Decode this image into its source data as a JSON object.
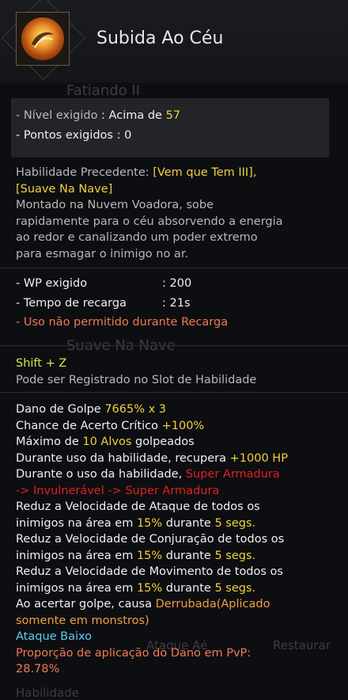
{
  "skill": {
    "title": "Subida Ao Céu",
    "icon": "skill-icon-fire-swirl"
  },
  "ghost_texts": {
    "top": "Fatiando II",
    "middle": "Suave Na Nave",
    "bottom_left": "Habilidade",
    "bottom_mid": "Ataque Aé",
    "bottom_right": "Restaurar"
  },
  "requirements": {
    "level_label": "- Nível exigido",
    "level_sep": " : Acima de ",
    "level_value": "57",
    "points_label": "- Pontos exigidos : 0"
  },
  "description": {
    "prereq_label": "Habilidade Precedente: ",
    "prereq_1": "[Vem que Tem III],",
    "prereq_2": "[Suave Na Nave]",
    "text_1": "Montado na Nuvem Voadora, sobe",
    "text_2": "rapidamente para o céu absorvendo a energia",
    "text_3": "ao redor e canalizando um poder extremo",
    "text_4": "para esmagar o inimigo no ar."
  },
  "costs": {
    "wp_label": "- WP exigido",
    "wp_value": ": 200",
    "cd_label": "- Tempo de recarga",
    "cd_value": ": 21s",
    "cd_note": "- Uso não permitido durante Recarga"
  },
  "command": {
    "keys": "Shift + Z",
    "slot_note": "Pode ser Registrado no Slot de Habilidade"
  },
  "effects": {
    "dmg_label": "Dano de Golpe ",
    "dmg_value": "7665% x 3",
    "crit_label": "Chance de Acerto Crítico ",
    "crit_value": "+100%",
    "max_label": "Máximo de ",
    "max_value": "10 Alvos",
    "max_suffix": " golpeados",
    "hp_label": "Durante uso da habilidade, recupera ",
    "hp_value": "+1000 HP",
    "armor_label": "Durante o uso da habilidade, ",
    "armor_value_1": "Super Armadura",
    "armor_value_2": "-> Invulnerável -> Super Armadura",
    "atk_1": "Reduz a Velocidade de Ataque de todos os",
    "atk_2a": "inimigos na área em ",
    "atk_pct": "15%",
    "atk_2b": " durante ",
    "atk_time": "5 segs.",
    "cast_1": "Reduz a Velocidade de Conjuração de todos os",
    "cast_2a": "inimigos na área em ",
    "cast_pct": "15%",
    "cast_2b": " durante ",
    "cast_time": "5 segs.",
    "move_1": "Reduz a Velocidade de Movimento de todos os",
    "move_2a": "inimigos na área em ",
    "move_pct": "15%",
    "move_2b": " durante ",
    "move_time": "5 segs.",
    "kd_label": "Ao acertar golpe, causa ",
    "kd_value_1": "Derrubada(Aplicado",
    "kd_value_2": "somente em monstros)",
    "low_attack": "Ataque Baixo",
    "pvp_label": "Proporção de aplicação do Dano em PvP:",
    "pvp_value": "28.78%"
  },
  "colors": {
    "highlight_yellow": "#f0d040",
    "highlight_orange": "#f0a040",
    "command_green": "#cde84a",
    "super_armor_red": "#e02020",
    "warning_salmon": "#f07a50",
    "low_attack_cyan": "#5ec8f0"
  }
}
